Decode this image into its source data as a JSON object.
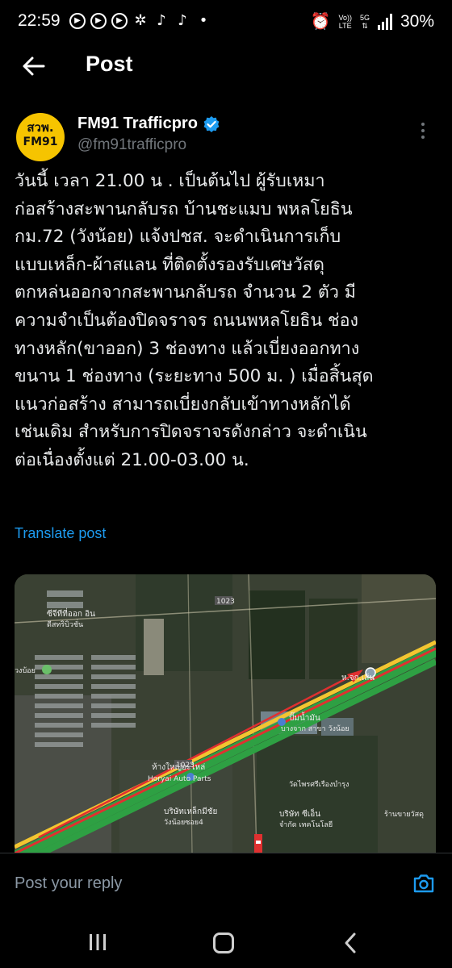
{
  "status_bar": {
    "time": "22:59",
    "network_vo": "Vo))",
    "network_lte": "LTE",
    "network_5g": "5G",
    "battery": "30%"
  },
  "header": {
    "title": "Post"
  },
  "post": {
    "avatar_line1": "สวพ.",
    "avatar_line2": "FM91",
    "display_name": "FM91 Trafficpro",
    "handle": "@fm91trafficpro",
    "text": "วันนี้  เวลา 21.00 น . เป็นต้นไป ผู้รับเหมา\nก่อสร้างสะพานกลับรถ บ้านชะแมบ พหลโยธิน\nกม.72 (วังน้อย)  แจ้งปชส. จะดำเนินการเก็บ\nแบบเหล็ก-ผ้าสแลน ที่ติดตั้งรองรับเศษวัสดุ\nตกหล่นออกจากสะพานกลับรถ จำนวน 2 ตัว มี\nความจำเป็นต้องปิดจราจร ถนนพหลโยธิน  ช่อง\nทางหลัก(ขาออก)  3 ช่องทาง แล้วเบี่ยงออกทาง\nขนาน 1 ช่องทาง  (ระยะทาง 500 ม. ) เมื่อสิ้นสุด\nแนวก่อสร้าง สามารถเบี่ยงกลับเข้าทางหลักได้\nเช่นเดิม  สำหรับการปิดจราจรดังกล่าว จะดำเนิน\nต่อเนื่องตั้งแต่ 21.00-03.00 น.",
    "translate_label": "Translate post"
  },
  "map_labels": {
    "route_top": "1023",
    "route_mid": "1023",
    "junction": "ห.จก.เส้น",
    "gas_station_1": "ปั๊มน้ำมัน",
    "gas_station_2": "บางจาก สาขา วังน้อย",
    "shop_1": "ห้างใหญ่อะไหล่",
    "shop_2": "Horyai Auto Parts",
    "left_top_1": "ซีจีทีที่ออก อิน",
    "left_top_2": "ดีสทริบิวชั่น",
    "left_mid": "วงบ้อย",
    "bottom_mid_1": "บริษัทเหล็กมีชัย",
    "bottom_mid_2": "วังน้อยซอย4",
    "bottom_right_1": "บริษัท ซีเอ็น",
    "bottom_right_2": "จำกัด เทคโนโลยี",
    "top_right": "วัดไพรศรีเรืองบำรุง",
    "far_right": "ร้านขายวัสดุ"
  },
  "colors": {
    "accent": "#1d9bf0",
    "avatar_bg": "#f6c400",
    "route_red": "#e03030",
    "route_green": "#2ea043",
    "route_yellow": "#f2c530"
  },
  "reply": {
    "placeholder": "Post your reply"
  }
}
